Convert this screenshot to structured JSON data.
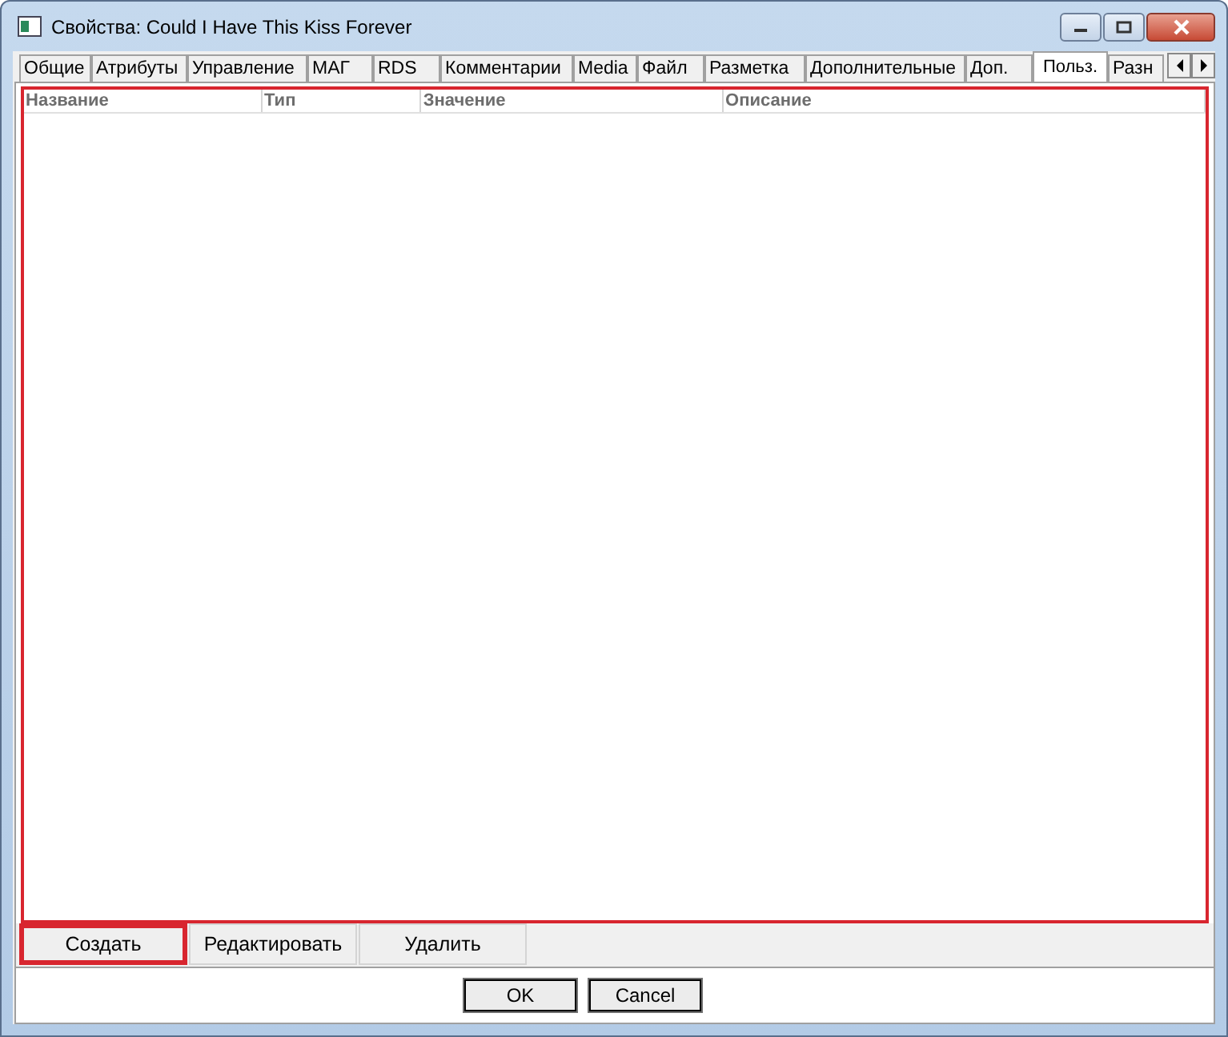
{
  "window": {
    "title": "Свойства: Could I Have This Kiss Forever"
  },
  "tabs": [
    {
      "label": "Общие",
      "selected": false
    },
    {
      "label": "Атрибуты",
      "selected": false
    },
    {
      "label": "Управление",
      "selected": false
    },
    {
      "label": "МАГ",
      "selected": false
    },
    {
      "label": "RDS",
      "selected": false
    },
    {
      "label": "Комментарии",
      "selected": false
    },
    {
      "label": "Media",
      "selected": false
    },
    {
      "label": "Файл",
      "selected": false
    },
    {
      "label": "Разметка",
      "selected": false
    },
    {
      "label": "Дополнительные",
      "selected": false
    },
    {
      "label": "Доп.",
      "selected": false
    },
    {
      "label": "Польз.",
      "selected": true
    },
    {
      "label": "Разн",
      "selected": false
    }
  ],
  "table": {
    "highlighted": true,
    "columns": [
      "Название",
      "Тип",
      "Значение",
      "Описание"
    ]
  },
  "actions": [
    {
      "label": "Создать",
      "highlighted": true
    },
    {
      "label": "Редактировать",
      "highlighted": false
    },
    {
      "label": "Удалить",
      "highlighted": false
    }
  ],
  "buttons": [
    "OK",
    "Cancel"
  ]
}
